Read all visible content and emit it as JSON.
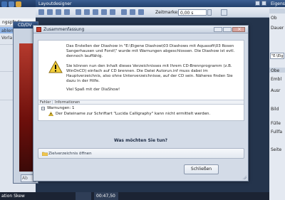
{
  "left_panel": {
    "tab_label": "ngspfade",
    "items": [
      "Vorla",
      "ablene"
    ],
    "status_label": "ation Skew"
  },
  "designer": {
    "title": "Layoutdesigner",
    "zoom_label": "Zeitmarke:",
    "zoom_value": "0,00 s",
    "timeline_time": "00:47,50"
  },
  "right_panel": {
    "title": "Eigens",
    "label_ob": "Ob",
    "label_dauer": "Dauer",
    "box_path": "\"E:\\Eig",
    "section_ob": "Obe",
    "label_embl": "Embl",
    "label_ausr": "Ausr",
    "label_bild": "Bild",
    "label_fulle": "Fülle",
    "label_fullfa": "Fullfa",
    "label_seite": "Seite"
  },
  "cd_window": {
    "title": "CD/DV",
    "button_label": "Ab"
  },
  "dialog": {
    "title": "Zusammenfassung",
    "paragraph1": "Das Erstellen der Diashow in \"E:\\Eigene Diashow\\03 Diashows mit Aquasoft\\03 Rosen Sangerhausen und Forst\\\" wurde mit Warnungen abgeschlossen. Die Diashow ist evtl. dennoch lauffähig.",
    "paragraph2": "Sie können nun den Inhalt dieses Verzeichnisses mit Ihrem CD-Brennprogramm (z.B. WinOnCD) einfach auf CD brennen. Die Datei Autorun.inf muss dabei im Hauptverzeichnis, also ohne Unterverzeichnisse, auf der CD sein. Näheres finden Sie dazu in der Hilfe.",
    "paragraph3": "Viel Spaß mit der DiaShow!",
    "details": {
      "columns": [
        "Fehler",
        "Informationen"
      ],
      "group": {
        "label": "Warnungen: 1",
        "rows": [
          {
            "message": "Der Dateiname zur Schriftart \"Lucida Calligraphy\" kann nicht ermittelt werden."
          }
        ]
      }
    },
    "question": "Was möchten Sie tun?",
    "open_dir_label": "Zielverzeichnis öffnen",
    "close_label": "Schließen"
  }
}
